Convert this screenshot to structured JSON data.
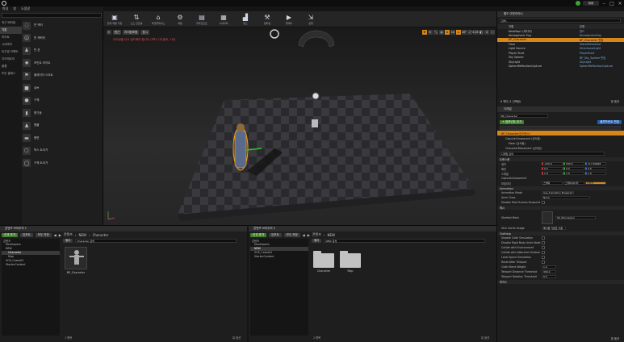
{
  "menu": {
    "items": [
      "파일",
      "창",
      "도움말"
    ]
  },
  "modes": {
    "categories": [
      "최근 배치됨",
      "기본",
      "라이트",
      "시네마틱",
      "비주얼 이펙트",
      "지오메트리",
      "볼륨",
      "모든 클래스"
    ],
    "items": [
      "빈 액터",
      "빈 캐릭터",
      "빈 폰",
      "포인트 라이트",
      "플레이어 스타트",
      "큐브",
      "구체",
      "원기둥",
      "원뿔",
      "평면",
      "박스 트리거",
      "구체 트리거"
    ]
  },
  "toolbar": {
    "buttons": [
      "현재 레벨 저장",
      "소스 컨트롤",
      "마켓플레이스",
      "세팅",
      "블루프린트",
      "시네마틱",
      "빌드",
      "컴파일",
      "플레이",
      "실행"
    ]
  },
  "viewport": {
    "perspective": "원근",
    "lit": "라이팅포함",
    "show": "표시",
    "warning": "라이팅을 다시 빌드해야 합니다 (액터 1개 필요, 1개)",
    "right_buttons": [
      "10",
      "10°",
      "0.25",
      "4"
    ]
  },
  "content_browser_1": {
    "tab": "콘텐츠 브라우저 1",
    "add": "신규 추가",
    "import": "임포트",
    "save": "모두 저장",
    "path": [
      "콘텐츠",
      "NEW",
      "Character"
    ],
    "filter": "필터",
    "search_placeholder": "Character 검색",
    "tree": [
      "콘텐츠",
      "Developers",
      "NEW",
      "Character",
      "Map",
      "SOE_Cases01",
      "StarterContent"
    ],
    "assets": [
      {
        "name": "BP_Character"
      }
    ],
    "footer": "1 항목",
    "view": "뷰 옵션"
  },
  "content_browser_2": {
    "tab": "콘텐츠 브라우저 2",
    "add": "신규 추가",
    "import": "임포트",
    "save": "모두 저장",
    "path": [
      "콘텐츠",
      "NEW"
    ],
    "filter": "필터",
    "search_placeholder": "NEW 검색",
    "tree": [
      "콘텐츠",
      "Developers",
      "NEW",
      "SOE_Cases01",
      "StarterContent"
    ],
    "assets": [
      {
        "name": "Character"
      },
      {
        "name": "Map"
      }
    ],
    "footer": "2 항목",
    "view": "뷰 옵션"
  },
  "outliner": {
    "tab": "월드 아웃라이너",
    "search_placeholder": "검색...",
    "col_label": "라벨",
    "col_type": "유형",
    "rows": [
      {
        "name": "NewMap1 (에디터)",
        "type": "월드"
      },
      {
        "name": "Atmospheric Fog",
        "type": "AtmosphericFog"
      },
      {
        "name": "BP_Character",
        "type": "BP_Character 편집"
      },
      {
        "name": "Floor",
        "type": "StaticMeshActor"
      },
      {
        "name": "Light Source",
        "type": "DirectionalLight"
      },
      {
        "name": "Player Start",
        "type": "PlayerStart"
      },
      {
        "name": "Sky Sphere",
        "type": "BP_Sky_Sphere 편집"
      },
      {
        "name": "SkyLight",
        "type": "SkyLight"
      },
      {
        "name": "SphereReflectionCapture",
        "type": "SphereReflectionCapture"
      }
    ],
    "footer": "9 액터 (1 선택됨)",
    "view": "뷰 옵션"
  },
  "details": {
    "tab": "디테일",
    "name": "BP_Character",
    "add_component": "+ 컴포넌트 추가",
    "blueprint": "블루프린트 편집",
    "self": "BP_Character(인스턴스)",
    "components": [
      "CapsuleComponent (상속됨)",
      "Mesh (상속됨)",
      "CharacterMovement (상속됨)"
    ],
    "search_placeholder": "디테일 검색",
    "transform": "트랜스폼",
    "location": {
      "label": "위치",
      "x": "-220.0",
      "y": "180.0",
      "z": "117.99998"
    },
    "rotation": {
      "label": "회전",
      "x": "0.0",
      "y": "0.0",
      "z": "0.0"
    },
    "scale": {
      "label": "스케일",
      "x": "1.0",
      "y": "1.0",
      "z": "1.0"
    },
    "component_label": "CapsuleComponent",
    "mobility": {
      "label": "모빌리티",
      "options": [
        "스태틱",
        "스테이셔너리",
        "무버블"
      ]
    },
    "animation": "Animation",
    "animation_mode": {
      "label": "Animation Mode",
      "value": "Use Animation Blueprint"
    },
    "anim_class": {
      "label": "Anim Class",
      "value": "None"
    },
    "disable_post_process": "Disable Post Process Blueprint",
    "mesh": "메시",
    "skeletal_mesh": {
      "label": "Skeletal Mesh",
      "value": "SK_Mannequin"
    },
    "skin_cache": {
      "label": "Skin Cache Usage",
      "value": "메시별 기본값 사용"
    },
    "clothing": "Clothing",
    "clothing_props": [
      "Disable Cloth Simulation",
      "Disable Rigid Body Anim Node",
      "Collide with Environment",
      "Collide with Attached Children",
      "Local Space Simulation",
      "Reset After Teleport"
    ],
    "cloth_blend_weight": {
      "label": "Cloth Blend Weight",
      "value": "1.0"
    },
    "teleport_distance": {
      "label": "Teleport Distance Threshold",
      "value": "300.0"
    },
    "teleport_rotation": {
      "label": "Teleport Rotation Threshold",
      "value": "0.0"
    },
    "physics": "피직스",
    "view": "뷰 옵션"
  },
  "colors": {
    "accent": "#d6861b",
    "add": "#3f7f2a",
    "blueprint": "#1f5fb3"
  }
}
